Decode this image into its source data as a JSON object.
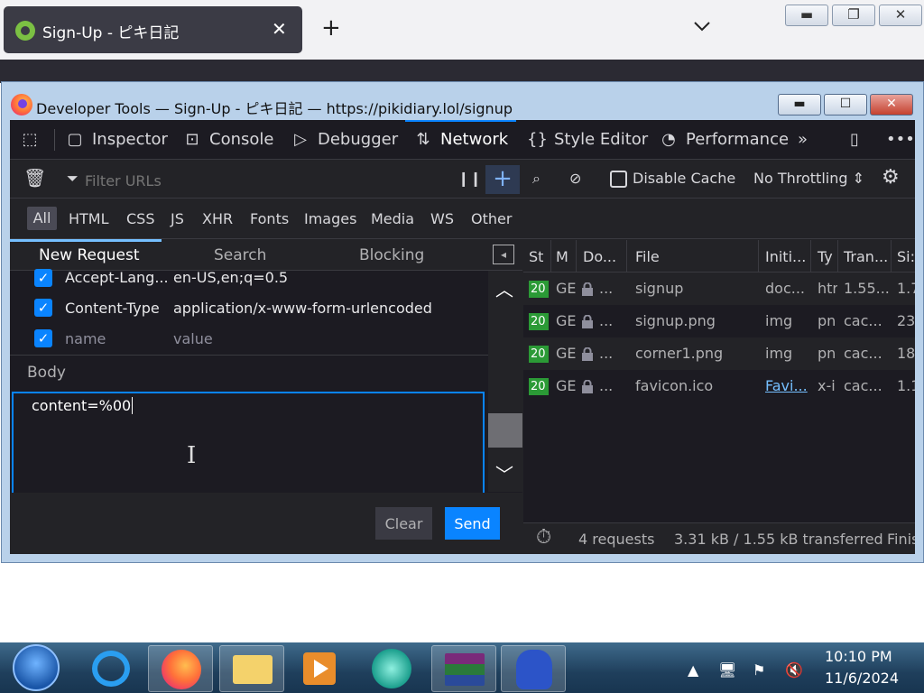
{
  "browser": {
    "tab_title": "Sign-Up - ピキ日記",
    "tab_close": "✕",
    "new_tab": "+"
  },
  "devtools": {
    "window_title": "Developer Tools — Sign-Up - ピキ日記 — https://pikidiary.lol/signup",
    "toolbar": {
      "inspector": "Inspector",
      "console": "Console",
      "debugger": "Debugger",
      "network": "Network",
      "style_editor": "Style Editor",
      "performance": "Performance"
    },
    "filter_placeholder": "Filter URLs",
    "disable_cache": "Disable Cache",
    "throttling": "No Throttling",
    "type_filters": [
      "All",
      "HTML",
      "CSS",
      "JS",
      "XHR",
      "Fonts",
      "Images",
      "Media",
      "WS",
      "Other"
    ],
    "new_request": {
      "tabs": [
        "New Request",
        "Search",
        "Blocking"
      ],
      "headers": [
        {
          "name": "Accept-Lang...",
          "value": "en-US,en;q=0.5"
        },
        {
          "name": "Content-Type",
          "value": "application/x-www-form-urlencoded"
        },
        {
          "name": "name",
          "value": "value"
        }
      ],
      "body_label": "Body",
      "body_value": "content=%00",
      "clear_label": "Clear",
      "send_label": "Send"
    },
    "table": {
      "columns": [
        "St",
        "M",
        "Do...",
        "File",
        "Initi...",
        "Ty",
        "Tran...",
        "Si:"
      ],
      "rows": [
        {
          "status": "20",
          "method": "GE",
          "domain": "...",
          "file": "signup",
          "initiator": "doc...",
          "type": "htr",
          "transferred": "1.55...",
          "size": "1.7"
        },
        {
          "status": "20",
          "method": "GE",
          "domain": "...",
          "file": "signup.png",
          "initiator": "img",
          "type": "pn",
          "transferred": "cac...",
          "size": "23"
        },
        {
          "status": "20",
          "method": "GE",
          "domain": "...",
          "file": "corner1.png",
          "initiator": "img",
          "type": "pn",
          "transferred": "cac...",
          "size": "18"
        },
        {
          "status": "20",
          "method": "GE",
          "domain": "...",
          "file": "favicon.ico",
          "initiator": "Favi...",
          "type": "x-i",
          "transferred": "cac...",
          "size": "1.1"
        }
      ],
      "summary": {
        "requests": "4 requests",
        "transferred": "3.31 kB / 1.55 kB transferred",
        "finish": "Finis"
      }
    }
  },
  "taskbar": {
    "time": "10:10 PM",
    "date": "11/6/2024"
  },
  "colors": {
    "accent": "#0a84ff",
    "status_ok": "#2b9a36",
    "panel_bg": "#1c1b22",
    "toolbar_bg": "#232327"
  }
}
